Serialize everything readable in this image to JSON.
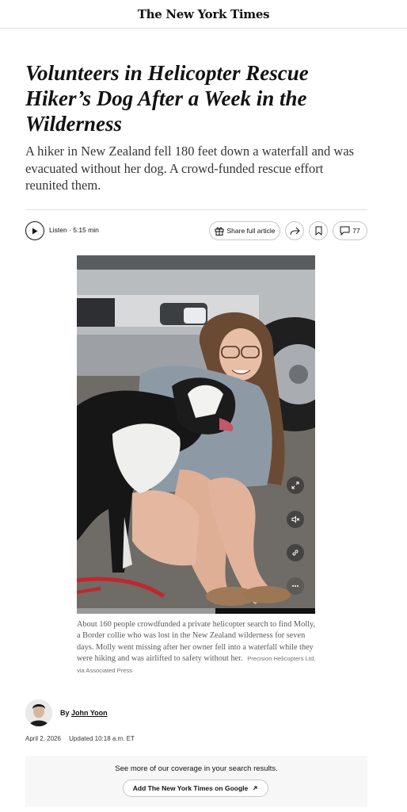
{
  "masthead": {
    "logo": "The New York Times"
  },
  "article": {
    "headline": "Volunteers in Helicopter Rescue Hiker’s Dog After a Week in the Wilderness",
    "summary": "A hiker in New Zealand fell 180 feet down a waterfall and was evacuated without her dog. A crowd-funded rescue effort reunited them."
  },
  "toolbar": {
    "listen_label": "Listen · 5:15 min",
    "share_full_label": "Share full article",
    "comment_count": "77",
    "icons": {
      "play": "play-icon",
      "gift": "gift-icon",
      "share": "share-arrow-icon",
      "save": "bookmark-icon",
      "comments": "comment-bubble-icon"
    }
  },
  "media": {
    "controls": [
      "expand-icon",
      "mute-icon",
      "link-icon",
      "more-icon"
    ],
    "progress_fraction": 0.58
  },
  "caption": {
    "text": "About 160 people crowdfunded a private helicopter search to find Molly, a Border collie who was lost in the New Zealand wilderness for seven days. Molly went missing after her owner fell into a waterfall while they were hiking and was airlifted to safety without her.",
    "credit": "Precision Helicopters Ltd, via Associated Press"
  },
  "byline": {
    "prefix": "By ",
    "author": "John Yoon"
  },
  "dates": {
    "published": "April 2, 2026",
    "updated": "Updated 10:18 a.m. ET"
  },
  "promo": {
    "text": "See more of our coverage in your search results.",
    "button_label": "Add The New York Times on Google"
  }
}
